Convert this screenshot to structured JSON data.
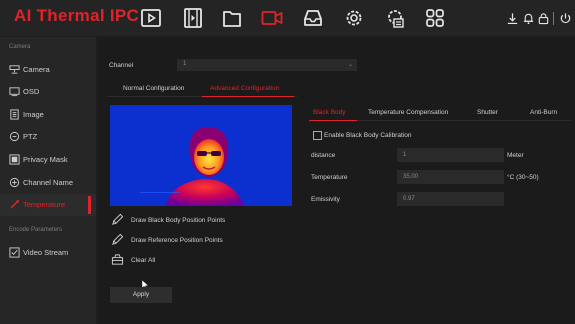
{
  "brand": {
    "title": "AI Thermal IPC"
  },
  "top_nav": [
    "playback-icon",
    "video-file-icon",
    "folder-icon",
    "camera-settings-icon",
    "storage-icon",
    "system-gear-icon",
    "maintenance-gear-icon",
    "apps-grid-icon"
  ],
  "top_right": [
    "download-icon",
    "bell-icon",
    "lock-icon",
    "power-icon"
  ],
  "sidebar": {
    "section_camera": "Camera",
    "section_encode": "Encode Parameters",
    "items": [
      {
        "label": "Camera",
        "icon": "camera-icon"
      },
      {
        "label": "OSD",
        "icon": "osd-icon"
      },
      {
        "label": "Image",
        "icon": "image-icon"
      },
      {
        "label": "PTZ",
        "icon": "ptz-icon"
      },
      {
        "label": "Privacy Mask",
        "icon": "privacy-mask-icon"
      },
      {
        "label": "Channel Name",
        "icon": "channel-name-icon"
      },
      {
        "label": "Temperature",
        "icon": "temperature-icon"
      },
      {
        "label": "Video Stream",
        "icon": "video-stream-icon"
      }
    ],
    "active_index": 6
  },
  "main": {
    "channel_label": "Channel",
    "channel_value": "1",
    "tabs": [
      "Normal Configuration",
      "Advanced Configuration"
    ],
    "active_tab": 1,
    "actions": {
      "draw_black_body": "Draw Black Body Position Points",
      "draw_reference": "Draw Reference Position Points",
      "clear_all": "Clear All"
    },
    "apply_label": "Apply",
    "sub_tabs": [
      "Black Body",
      "Temperature Compensation",
      "Shutter",
      "Anti-Burn"
    ],
    "active_sub_tab": 0,
    "enable_label": "Enable Black Body Calibration",
    "fields": [
      {
        "label": "distance",
        "value": "1",
        "unit": "Meter"
      },
      {
        "label": "Temperature",
        "value": "35.00",
        "unit": "°C (30~50)"
      },
      {
        "label": "Emissivity",
        "value": "0.97",
        "unit": ""
      }
    ]
  },
  "colors": {
    "accent": "#e0232a",
    "thermal_bg": "#0a2ccc"
  }
}
